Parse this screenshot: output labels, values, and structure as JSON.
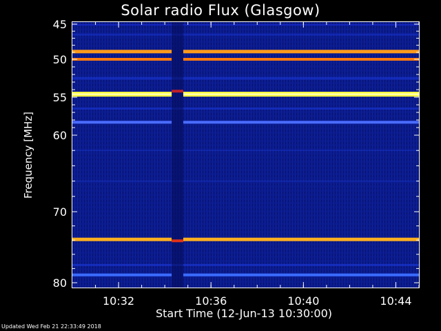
{
  "chart_data": {
    "type": "heatmap",
    "title": "Solar radio Flux (Glasgow)",
    "xlabel": "Start Time (12-Jun-13 10:30:00)",
    "ylabel": "Frequency [MHz]",
    "x_ticks": [
      "10:32",
      "10:36",
      "10:40",
      "10:44"
    ],
    "x_tick_minutes": [
      2,
      6,
      10,
      14
    ],
    "x_range_minutes": [
      0,
      15
    ],
    "y_ticks": [
      45,
      50,
      55,
      60,
      70,
      80
    ],
    "y_range": [
      44.5,
      80.5
    ],
    "y_scale": "nonlinear (decreasing spacing toward high frequency)",
    "emission_lines": [
      {
        "freq": 48.9,
        "intensity": "high",
        "color": "#ff9a1a"
      },
      {
        "freq": 50.0,
        "intensity": "medium, intermittent",
        "color": "#ff7a10"
      },
      {
        "freq": 54.6,
        "intensity": "very high",
        "color": "#ffff40"
      },
      {
        "freq": 58.3,
        "intensity": "low",
        "color": "#4a6cff"
      },
      {
        "freq": 73.9,
        "intensity": "high",
        "color": "#ffb020"
      },
      {
        "freq": 78.9,
        "intensity": "low",
        "color": "#3b6cff"
      }
    ],
    "data_gap_minutes": [
      4.3,
      4.8
    ]
  },
  "footer": {
    "updated": "Updated Wed Feb 21 22:33:49 2018"
  },
  "colors": {
    "background": "#000000",
    "base": "#0a1a8a",
    "text": "#ffffff"
  }
}
